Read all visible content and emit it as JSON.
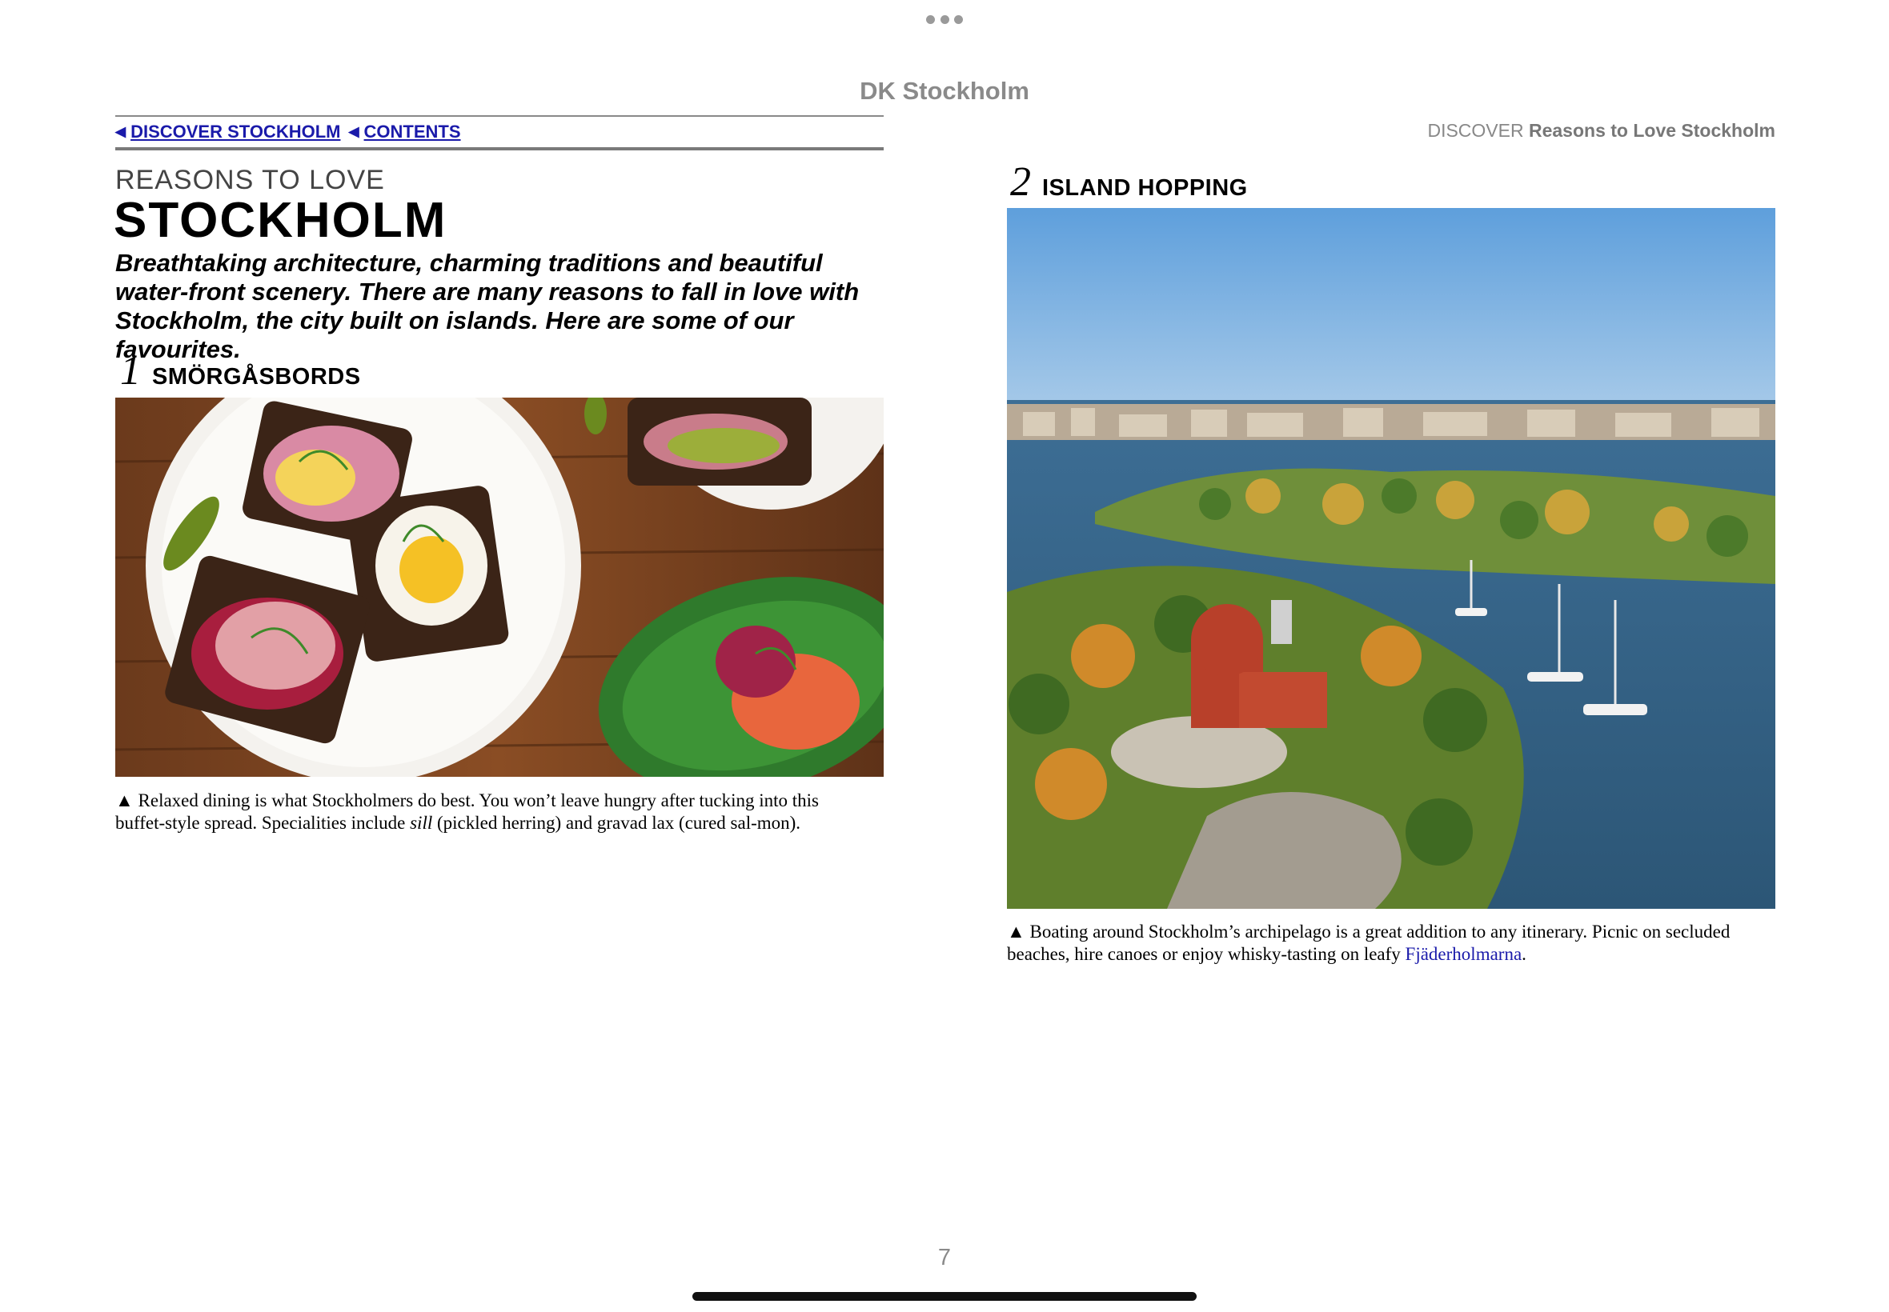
{
  "book_title": "DK Stockholm",
  "nav": {
    "link1": "DISCOVER STOCKHOLM",
    "link2": "CONTENTS"
  },
  "left_page": {
    "kicker": "REASONS TO LOVE",
    "title": "STOCKHOLM",
    "intro": "Breathtaking architecture, charming traditions and beautiful water-front scenery. There are many reasons to fall in love with Stockholm, the city built on islands. Here are some of our favourites.",
    "item1": {
      "number": "1",
      "label": "SMÖRGÅSBORDS",
      "caption_pre": "▲ Relaxed dining is what Stockholmers do best. You won’t leave hungry after tucking into this buffet-style spread. Specialities include ",
      "caption_italic": "sill",
      "caption_post": " (pickled herring) and gravad lax (cured sal-mon)."
    }
  },
  "right_page": {
    "header_section": "DISCOVER",
    "header_title": "Reasons to Love Stockholm",
    "item2": {
      "number": "2",
      "label": "ISLAND HOPPING",
      "caption_pre": "▲ Boating around Stockholm’s archipelago is a great addition to any itinerary. Picnic on secluded beaches, hire canoes or enjoy whisky-tasting on leafy ",
      "caption_link": "Fjäderholmarna",
      "caption_post": "."
    }
  },
  "page_number": "7",
  "colors": {
    "link": "#1a1aaa",
    "muted": "#8a8a8a"
  }
}
